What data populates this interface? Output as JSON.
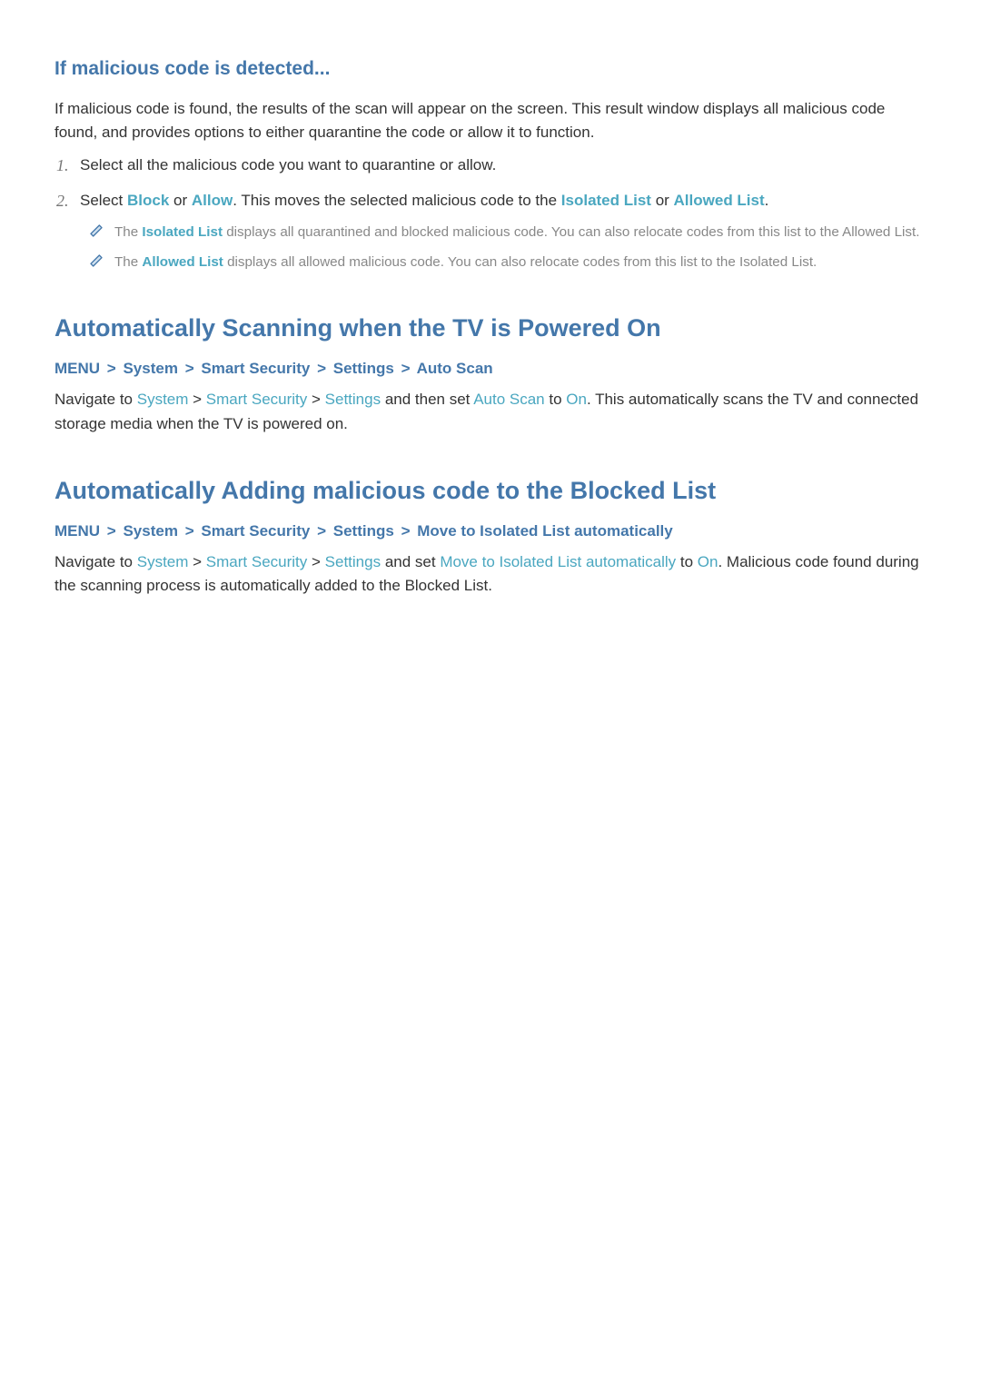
{
  "section1": {
    "heading": "If malicious code is detected...",
    "intro": "If malicious code is found, the results of the scan will appear on the screen. This result window displays all malicious code found, and provides options to either quarantine the code or allow it to function.",
    "steps": {
      "s1": {
        "num": "1.",
        "text": "Select all the malicious code you want to quarantine or allow."
      },
      "s2": {
        "num": "2.",
        "pre1": "Select ",
        "block": "Block",
        "mid1": " or ",
        "allow": "Allow",
        "mid2": ". This moves the selected malicious code to the ",
        "isolatedList": "Isolated List",
        "mid3": " or ",
        "allowedList": "Allowed List",
        "post": ".",
        "notes": {
          "n1": {
            "pre": "The ",
            "highlight": "Isolated List",
            "post": " displays all quarantined and blocked malicious code. You can also relocate codes from this list to the Allowed List."
          },
          "n2": {
            "pre": "The ",
            "highlight": "Allowed List",
            "post": " displays all allowed malicious code. You can also relocate codes from this list to the Isolated List."
          }
        }
      }
    }
  },
  "section2": {
    "heading": "Automatically Scanning when the TV is Powered On",
    "bc": {
      "i0": "MENU",
      "i1": "System",
      "i2": "Smart Security",
      "i3": "Settings",
      "i4": "Auto Scan"
    },
    "para": {
      "pre": "Navigate to ",
      "p1": "System",
      "s1": " > ",
      "p2": "Smart Security",
      "s2": " > ",
      "p3": "Settings",
      "mid1": " and then set ",
      "p4": "Auto Scan",
      "mid2": " to ",
      "p5": "On",
      "post": ". This automatically scans the TV and connected storage media when the TV is powered on."
    }
  },
  "section3": {
    "heading": "Automatically Adding malicious code to the Blocked List",
    "bc": {
      "i0": "MENU",
      "i1": "System",
      "i2": "Smart Security",
      "i3": "Settings",
      "i4": "Move to Isolated List automatically"
    },
    "para": {
      "pre": "Navigate to ",
      "p1": "System",
      "s1": " > ",
      "p2": "Smart Security",
      "s2": " > ",
      "p3": "Settings",
      "mid1": " and set ",
      "p4": "Move to Isolated List automatically",
      "mid2": " to ",
      "p5": "On",
      "post": ". Malicious code found during the scanning process is automatically added to the Blocked List."
    }
  },
  "sep": ">"
}
